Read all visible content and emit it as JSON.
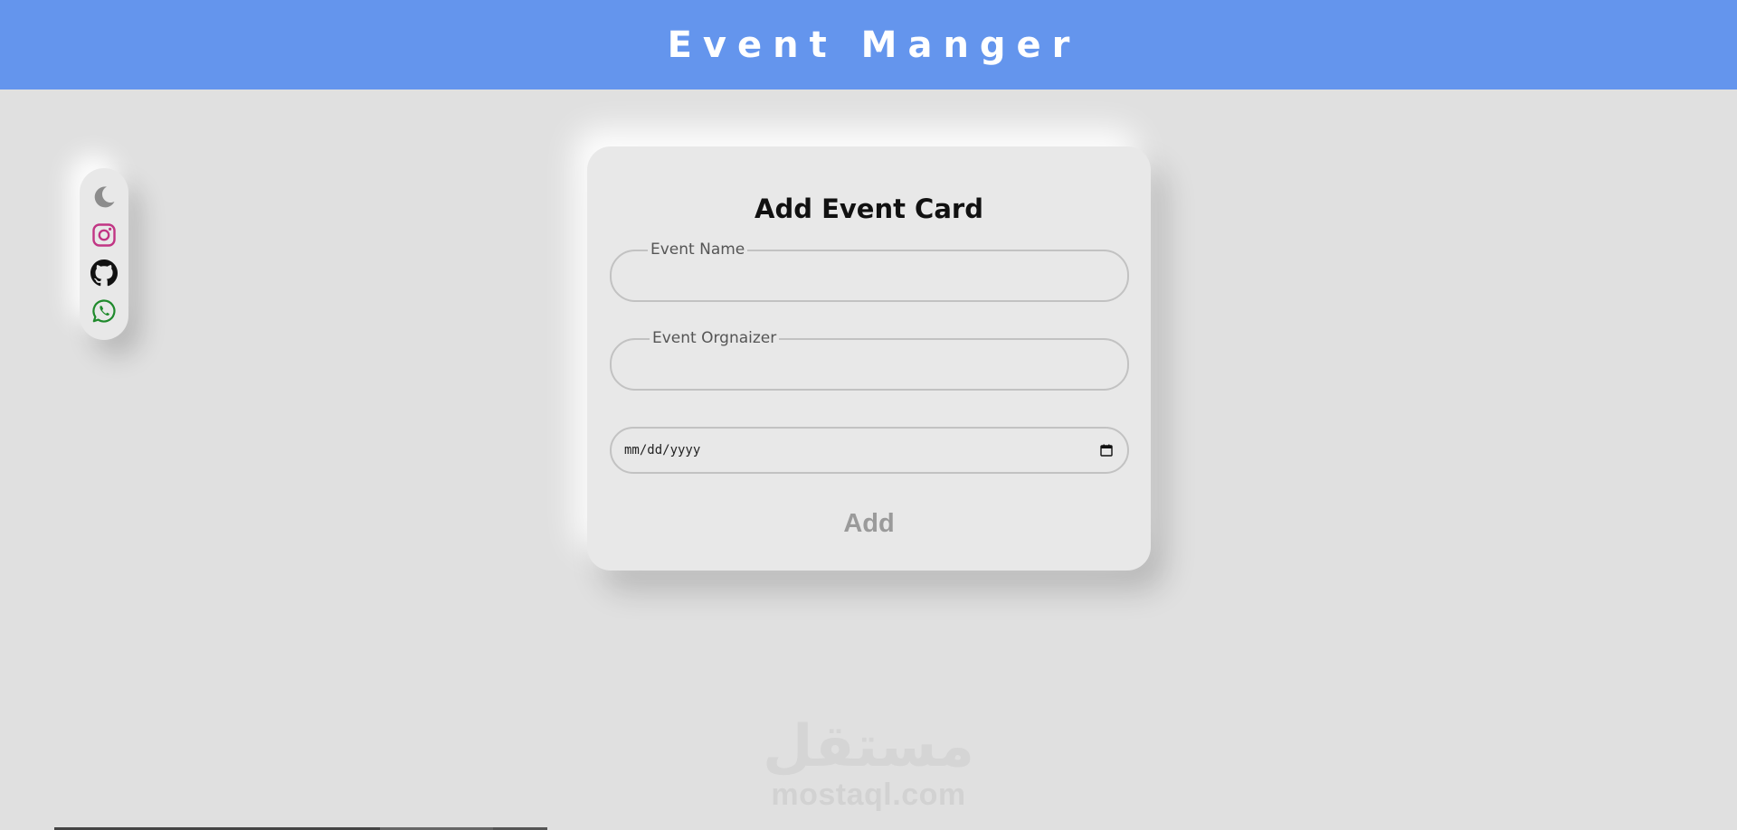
{
  "header": {
    "title": "Event Manger",
    "bg_color": "#6495ed"
  },
  "social": {
    "items": [
      {
        "icon": "moon-icon",
        "label": "theme toggle",
        "color": "#8c8c8c"
      },
      {
        "icon": "instagram-icon",
        "label": "instagram",
        "color": "#c13584"
      },
      {
        "icon": "github-icon",
        "label": "github",
        "color": "#111111"
      },
      {
        "icon": "whatsapp-icon",
        "label": "whatsapp",
        "color": "#1f8a2c"
      }
    ]
  },
  "form": {
    "title": "Add Event Card",
    "event_name_label": "Event Name",
    "event_name_value": "",
    "organizer_label": "Event Orgnaizer",
    "organizer_value": "",
    "date_placeholder": "mm/dd/yyyy",
    "add_label": "Add"
  },
  "watermark": {
    "arabic": "مستقل",
    "latin": "mostaql.com"
  }
}
